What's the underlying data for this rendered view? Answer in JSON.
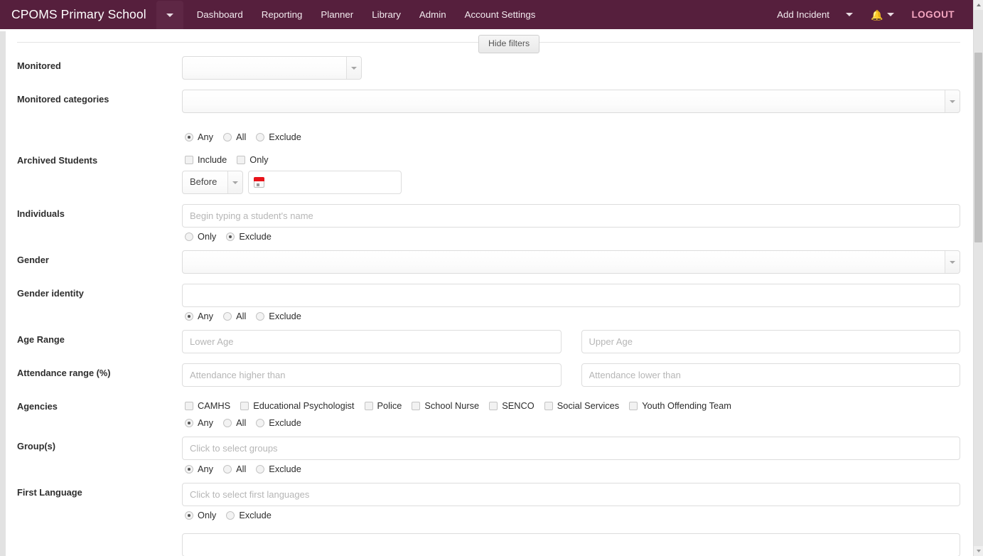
{
  "navbar": {
    "brand": "CPOMS Primary School",
    "brand_caret_icon": "chevron-down-icon",
    "links": [
      {
        "label": "Dashboard"
      },
      {
        "label": "Reporting"
      },
      {
        "label": "Planner"
      },
      {
        "label": "Library"
      },
      {
        "label": "Admin"
      },
      {
        "label": "Account Settings"
      }
    ],
    "add_incident_label": "Add Incident",
    "add_incident_caret_icon": "chevron-down-icon",
    "bell_icon": "bell-icon",
    "bell_caret_icon": "chevron-down-icon",
    "logout_label": "LOGOUT",
    "brand_color": "#561f3d",
    "logout_color": "#f4a6c0"
  },
  "toolbar": {
    "hide_filters_label": "Hide filters"
  },
  "filters": {
    "monitored": {
      "label": "Monitored",
      "value": "",
      "arrow_icon": "chevron-down-icon"
    },
    "monitored_categories": {
      "label": "Monitored categories",
      "value": "",
      "arrow_icon": "chevron-down-icon",
      "options": [
        {
          "label": "Any",
          "selected": true
        },
        {
          "label": "All",
          "selected": false
        },
        {
          "label": "Exclude",
          "selected": false
        }
      ]
    },
    "archived_students": {
      "label": "Archived Students",
      "checkboxes": [
        {
          "label": "Include",
          "checked": false
        },
        {
          "label": "Only",
          "checked": false
        }
      ],
      "comparator": "Before",
      "comparator_arrow_icon": "chevron-down-icon",
      "date_value": "",
      "calendar_icon": "calendar-icon"
    },
    "individuals": {
      "label": "Individuals",
      "value": "",
      "placeholder": "Begin typing a student's name",
      "options": [
        {
          "label": "Only",
          "selected": false
        },
        {
          "label": "Exclude",
          "selected": true
        }
      ]
    },
    "gender": {
      "label": "Gender",
      "value": "",
      "arrow_icon": "chevron-down-icon"
    },
    "gender_identity": {
      "label": "Gender identity",
      "value": "",
      "options": [
        {
          "label": "Any",
          "selected": true
        },
        {
          "label": "All",
          "selected": false
        },
        {
          "label": "Exclude",
          "selected": false
        }
      ]
    },
    "age_range": {
      "label": "Age Range",
      "lower_value": "",
      "lower_placeholder": "Lower Age",
      "upper_value": "",
      "upper_placeholder": "Upper Age"
    },
    "attendance_range": {
      "label": "Attendance range (%)",
      "higher_value": "",
      "higher_placeholder": "Attendance higher than",
      "lower_value": "",
      "lower_placeholder": "Attendance lower than"
    },
    "agencies": {
      "label": "Agencies",
      "checkboxes": [
        {
          "label": "CAMHS",
          "checked": false
        },
        {
          "label": "Educational Psychologist",
          "checked": false
        },
        {
          "label": "Police",
          "checked": false
        },
        {
          "label": "School Nurse",
          "checked": false
        },
        {
          "label": "SENCO",
          "checked": false
        },
        {
          "label": "Social Services",
          "checked": false
        },
        {
          "label": "Youth Offending Team",
          "checked": false
        }
      ],
      "options": [
        {
          "label": "Any",
          "selected": true
        },
        {
          "label": "All",
          "selected": false
        },
        {
          "label": "Exclude",
          "selected": false
        }
      ]
    },
    "groups": {
      "label": "Group(s)",
      "value": "",
      "placeholder": "Click to select groups",
      "options": [
        {
          "label": "Any",
          "selected": true
        },
        {
          "label": "All",
          "selected": false
        },
        {
          "label": "Exclude",
          "selected": false
        }
      ]
    },
    "first_language": {
      "label": "First Language",
      "value": "",
      "placeholder": "Click to select first languages",
      "options": [
        {
          "label": "Only",
          "selected": true
        },
        {
          "label": "Exclude",
          "selected": false
        }
      ]
    }
  },
  "scrollbar": {
    "up_icon": "triangle-up-icon",
    "down_icon": "triangle-down-icon"
  }
}
